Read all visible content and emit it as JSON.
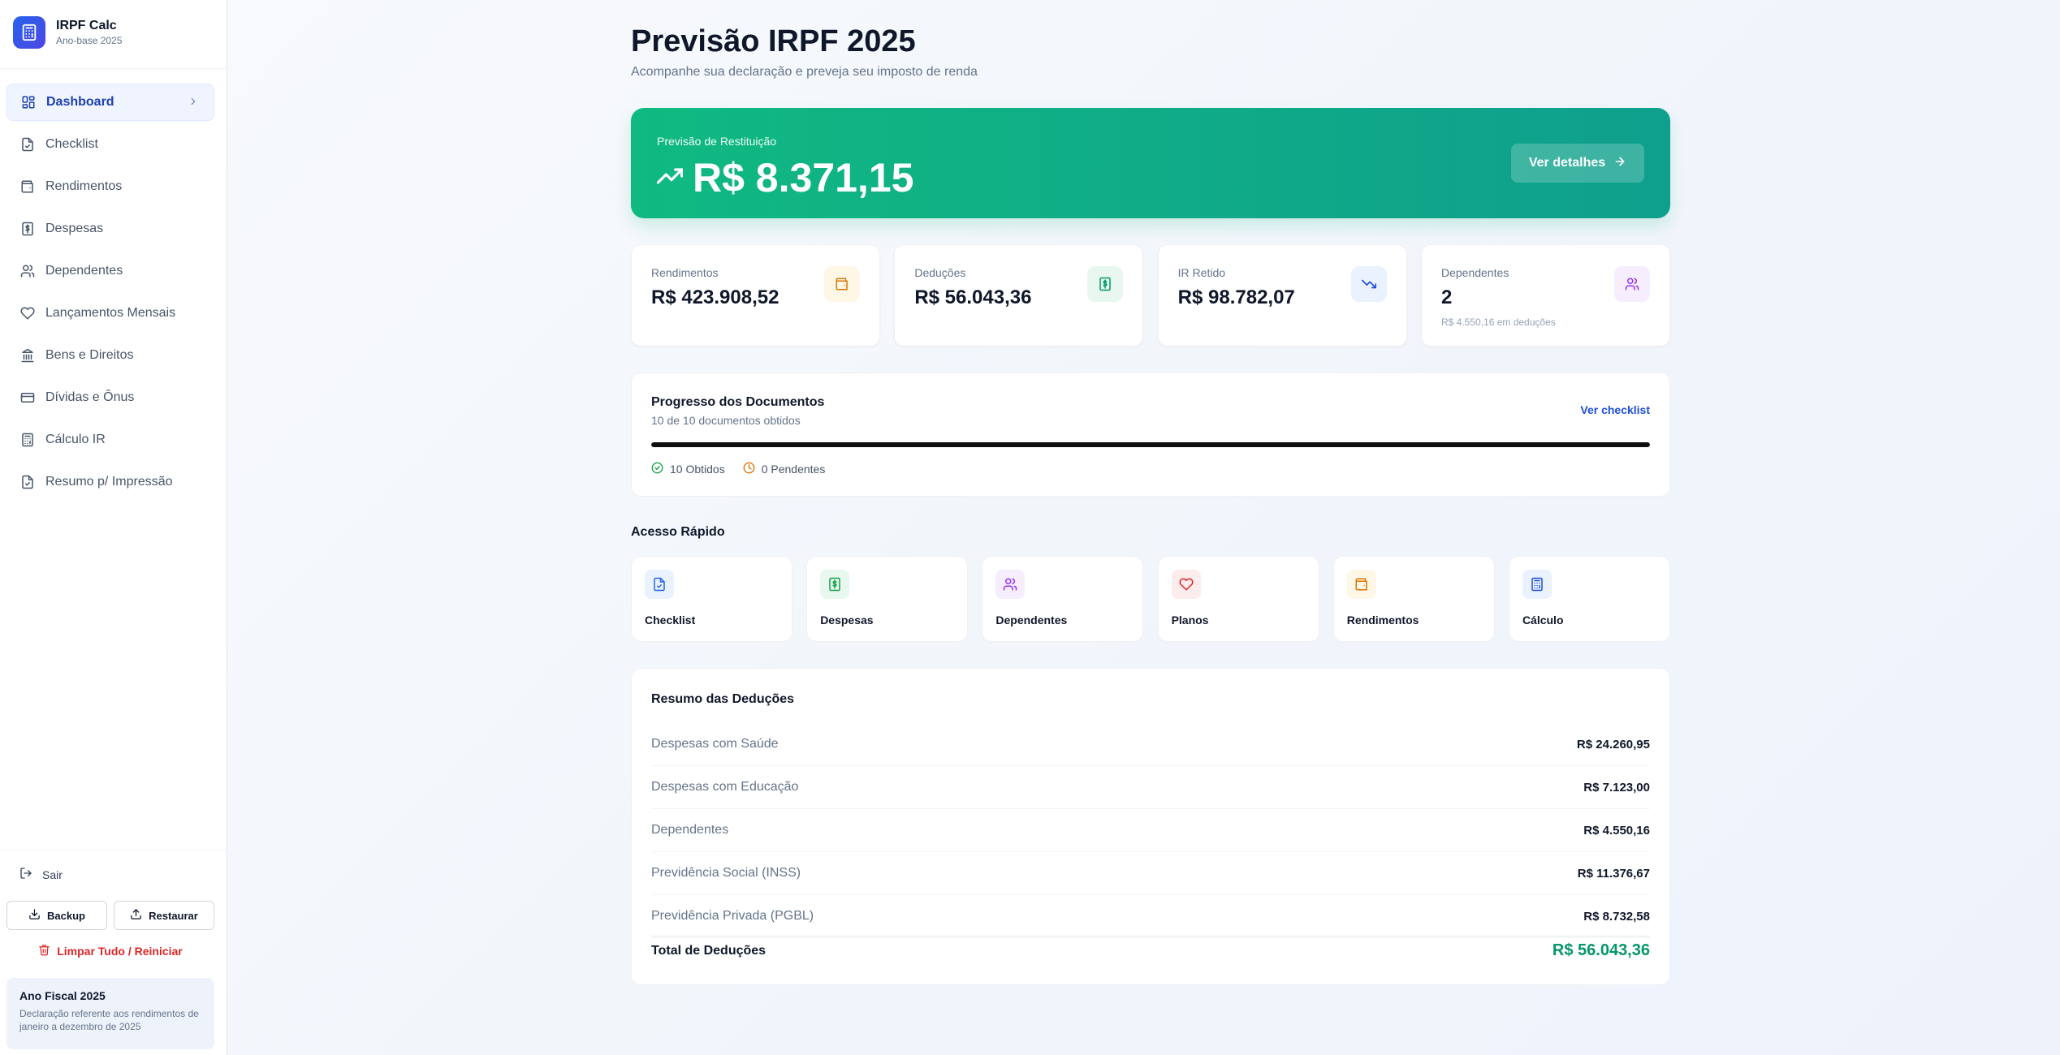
{
  "brand": {
    "title": "IRPF Calc",
    "subtitle": "Ano-base 2025"
  },
  "sidebar": {
    "items": [
      {
        "label": "Dashboard",
        "icon": "dashboard-icon",
        "active": true
      },
      {
        "label": "Checklist",
        "icon": "file-check-icon"
      },
      {
        "label": "Rendimentos",
        "icon": "wallet-icon"
      },
      {
        "label": "Despesas",
        "icon": "receipt-icon"
      },
      {
        "label": "Dependentes",
        "icon": "users-icon"
      },
      {
        "label": "Lançamentos Mensais",
        "icon": "heart-icon"
      },
      {
        "label": "Bens e Direitos",
        "icon": "bank-icon"
      },
      {
        "label": "Dívidas e Ônus",
        "icon": "credit-card-icon"
      },
      {
        "label": "Cálculo IR",
        "icon": "calculator-icon"
      },
      {
        "label": "Resumo p/ Impressão",
        "icon": "file-check-icon"
      }
    ],
    "logout": "Sair",
    "backup": "Backup",
    "restore": "Restaurar",
    "clear": "Limpar Tudo / Reiniciar",
    "fiscal_title": "Ano Fiscal 2025",
    "fiscal_desc": "Declaração referente aos rendimentos de janeiro a dezembro de 2025"
  },
  "header": {
    "title": "Previsão IRPF 2025",
    "subtitle": "Acompanhe sua declaração e preveja seu imposto de renda"
  },
  "hero": {
    "label": "Previsão de Restituição",
    "amount": "R$ 8.371,15",
    "button": "Ver detalhes"
  },
  "stats": [
    {
      "label": "Rendimentos",
      "value": "R$ 423.908,52",
      "note": "",
      "icon": "wallet-icon",
      "color": "#d97706",
      "bg": "#fff7e6"
    },
    {
      "label": "Deduções",
      "value": "R$ 56.043,36",
      "note": "",
      "icon": "receipt-icon",
      "color": "#059669",
      "bg": "#e8f8f0"
    },
    {
      "label": "IR Retido",
      "value": "R$ 98.782,07",
      "note": "",
      "icon": "trending-down-icon",
      "color": "#1d4ed8",
      "bg": "#eaf1ff"
    },
    {
      "label": "Dependentes",
      "value": "2",
      "note": "R$ 4.550,16 em deduções",
      "icon": "users-icon",
      "color": "#9333ea",
      "bg": "#f6edff"
    }
  ],
  "progress": {
    "title": "Progresso dos Documentos",
    "subtitle": "10 de 10 documentos obtidos",
    "link": "Ver checklist",
    "fraction": 1.0,
    "obtained": "10 Obtidos",
    "pending": "0 Pendentes"
  },
  "quick": {
    "title": "Acesso Rápido",
    "items": [
      {
        "label": "Checklist",
        "icon": "file-check-icon",
        "color": "#2563eb",
        "bg": "#eaf1ff"
      },
      {
        "label": "Despesas",
        "icon": "receipt-icon",
        "color": "#16a34a",
        "bg": "#e8f8ee"
      },
      {
        "label": "Dependentes",
        "icon": "users-icon",
        "color": "#9333ea",
        "bg": "#f6edff"
      },
      {
        "label": "Planos",
        "icon": "heart-icon",
        "color": "#dc2626",
        "bg": "#fdecec"
      },
      {
        "label": "Rendimentos",
        "icon": "wallet-icon",
        "color": "#d97706",
        "bg": "#fff7e6"
      },
      {
        "label": "Cálculo",
        "icon": "calculator-icon",
        "color": "#1d4ed8",
        "bg": "#eaf1ff"
      }
    ]
  },
  "deductions": {
    "title": "Resumo das Deduções",
    "rows": [
      {
        "label": "Despesas com Saúde",
        "value": "R$ 24.260,95"
      },
      {
        "label": "Despesas com Educação",
        "value": "R$ 7.123,00"
      },
      {
        "label": "Dependentes",
        "value": "R$ 4.550,16"
      },
      {
        "label": "Previdência Social (INSS)",
        "value": "R$ 11.376,67"
      },
      {
        "label": "Previdência Privada (PGBL)",
        "value": "R$ 8.732,58"
      }
    ],
    "total_label": "Total de Deduções",
    "total_value": "R$ 56.043,36"
  }
}
